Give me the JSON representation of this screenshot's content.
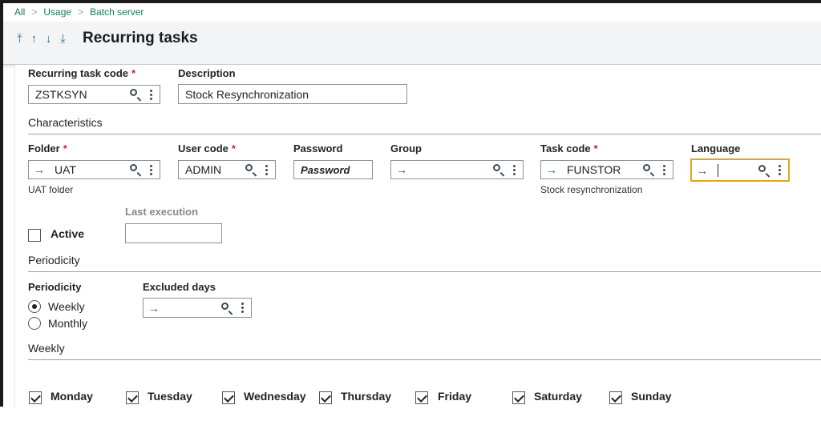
{
  "breadcrumb": {
    "items": [
      "All",
      "Usage",
      "Batch server"
    ],
    "separator": ">"
  },
  "nav": {
    "first": "⤒",
    "prev": "↑",
    "next": "↓",
    "last": "⤓"
  },
  "page": {
    "title": "Recurring tasks"
  },
  "form": {
    "task_code": {
      "label": "Recurring task code",
      "required": "*",
      "value": "ZSTKSYN"
    },
    "description": {
      "label": "Description",
      "value": "Stock Resynchronization"
    },
    "characteristics": {
      "section_title": "Characteristics",
      "folder": {
        "label": "Folder",
        "required": "*",
        "value": "UAT",
        "helper": "UAT folder"
      },
      "user_code": {
        "label": "User code",
        "required": "*",
        "value": "ADMIN"
      },
      "password": {
        "label": "Password",
        "value": "Password"
      },
      "group": {
        "label": "Group",
        "value": ""
      },
      "task_code": {
        "label": "Task code",
        "required": "*",
        "value": "FUNSTOR",
        "helper": "Stock resynchronization"
      },
      "language": {
        "label": "Language",
        "value": ""
      },
      "active": {
        "label": "Active",
        "checked": false
      },
      "last_execution": {
        "label": "Last execution",
        "value": ""
      }
    },
    "periodicity": {
      "section_title": "Periodicity",
      "label": "Periodicity",
      "options": [
        {
          "label": "Weekly",
          "selected": true
        },
        {
          "label": "Monthly",
          "selected": false
        }
      ],
      "excluded_days": {
        "label": "Excluded days",
        "value": ""
      }
    },
    "weekly": {
      "section_title": "Weekly",
      "days": [
        {
          "label": "Monday",
          "checked": true
        },
        {
          "label": "Tuesday",
          "checked": true
        },
        {
          "label": "Wednesday",
          "checked": true
        },
        {
          "label": "Thursday",
          "checked": true
        },
        {
          "label": "Friday",
          "checked": true
        },
        {
          "label": "Saturday",
          "checked": true
        },
        {
          "label": "Sunday",
          "checked": true
        }
      ]
    }
  },
  "icons": {
    "arrow": "→",
    "search": "search-icon",
    "more": "kebab-icon"
  },
  "colors": {
    "link": "#1a7a5a",
    "required": "#d1202f",
    "focus": "#e0a51e",
    "header_bg": "#f3f4f5"
  }
}
